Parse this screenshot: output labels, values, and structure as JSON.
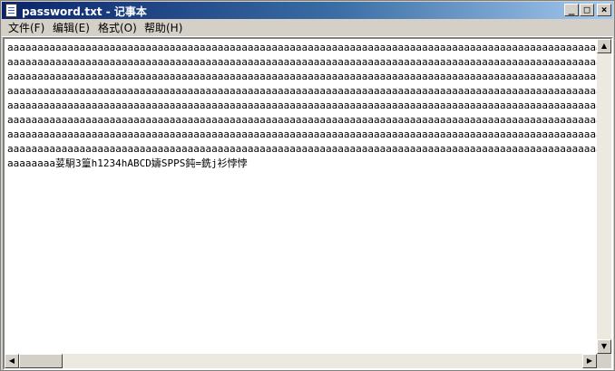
{
  "window": {
    "title": "password.txt - 记事本",
    "minimize_glyph": "_",
    "maximize_glyph": "□",
    "close_glyph": "×"
  },
  "menu": [
    {
      "label": "文件(F)"
    },
    {
      "label": "编辑(E)"
    },
    {
      "label": "格式(O)"
    },
    {
      "label": "帮助(H)"
    }
  ],
  "document": {
    "lines": [
      "aaaaaaaaaaaaaaaaaaaaaaaaaaaaaaaaaaaaaaaaaaaaaaaaaaaaaaaaaaaaaaaaaaaaaaaaaaaaaaaaaaaaaaaaaaaaaaaaaaaaaaa",
      "aaaaaaaaaaaaaaaaaaaaaaaaaaaaaaaaaaaaaaaaaaaaaaaaaaaaaaaaaaaaaaaaaaaaaaaaaaaaaaaaaaaaaaaaaaaaaaaaaaaaaaa",
      "aaaaaaaaaaaaaaaaaaaaaaaaaaaaaaaaaaaaaaaaaaaaaaaaaaaaaaaaaaaaaaaaaaaaaaaaaaaaaaaaaaaaaaaaaaaaaaaaaaaaaaa",
      "aaaaaaaaaaaaaaaaaaaaaaaaaaaaaaaaaaaaaaaaaaaaaaaaaaaaaaaaaaaaaaaaaaaaaaaaaaaaaaaaaaaaaaaaaaaaaaaaaaaaaaa",
      "aaaaaaaaaaaaaaaaaaaaaaaaaaaaaaaaaaaaaaaaaaaaaaaaaaaaaaaaaaaaaaaaaaaaaaaaaaaaaaaaaaaaaaaaaaaaaaaaaaaaaaa",
      "aaaaaaaaaaaaaaaaaaaaaaaaaaaaaaaaaaaaaaaaaaaaaaaaaaaaaaaaaaaaaaaaaaaaaaaaaaaaaaaaaaaaaaaaaaaaaaaaaaaaaaa",
      "aaaaaaaaaaaaaaaaaaaaaaaaaaaaaaaaaaaaaaaaaaaaaaaaaaaaaaaaaaaaaaaaaaaaaaaaaaaaaaaaaaaaaaaaaaaaaaaaaaaaaaa",
      "aaaaaaaaaaaaaaaaaaaaaaaaaaaaaaaaaaaaaaaaaaaaaaaaaaaaaaaaaaaaaaaaaaaaaaaaaaaaaaaaaaaaaaaaaaaaaaaaaaaaaaa",
      "aaaaaaaa荽駉3篁h1234hABCD嬦SPPS鈍=銑j衫悖悖"
    ]
  },
  "colors": {
    "titlebar_start": "#0a246a",
    "titlebar_end": "#a6caf0",
    "chrome": "#d4d0c8",
    "editor_bg": "#ffffff"
  },
  "icons": {
    "app": "notepad-icon",
    "scroll_up": "▲",
    "scroll_down": "▼",
    "scroll_left": "◀",
    "scroll_right": "▶"
  }
}
